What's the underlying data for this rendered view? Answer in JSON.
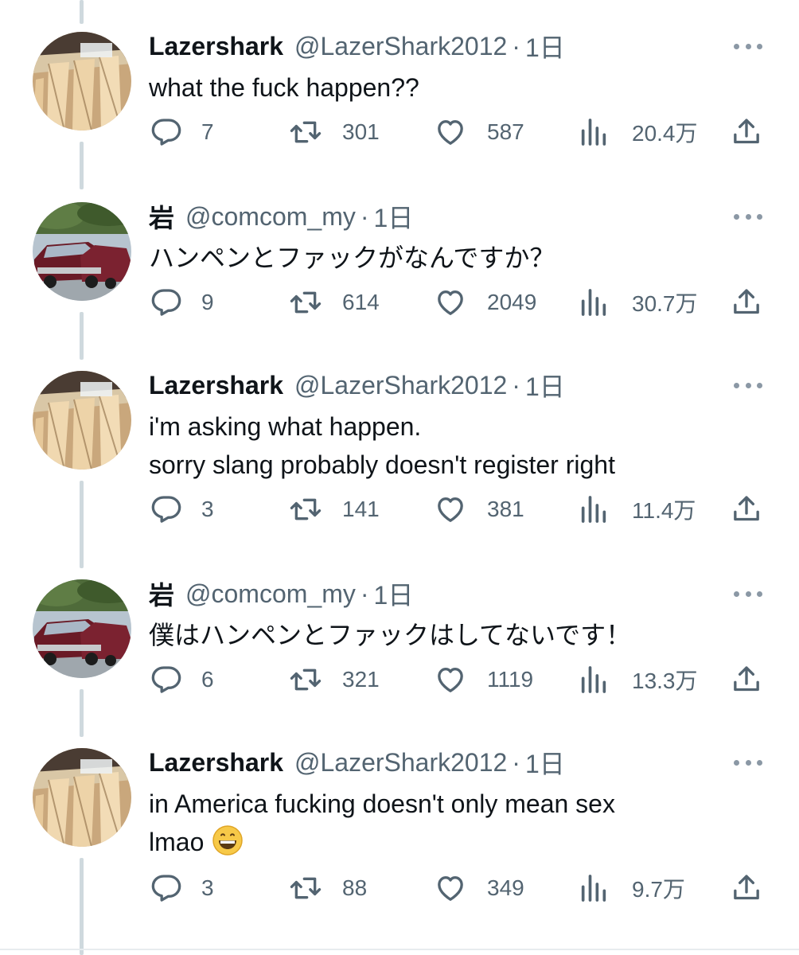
{
  "colors": {
    "text": "#0f1419",
    "secondary": "#536471",
    "thread_line": "#cfd9de"
  },
  "tweets": [
    {
      "name": "Lazershark",
      "handle": "@LazerShark2012",
      "dot": "·",
      "time": "1日",
      "avatar": "anime-hands-avatar",
      "text": [
        "what the fuck happen??"
      ],
      "replies": "7",
      "retweets": "301",
      "likes": "587",
      "views": "20.4万"
    },
    {
      "name": "岩",
      "handle": "@comcom_my",
      "dot": "·",
      "time": "1日",
      "avatar": "red-cars-avatar",
      "text": [
        "ハンペンとファックがなんですか？"
      ],
      "replies": "9",
      "retweets": "614",
      "likes": "2049",
      "views": "30.7万"
    },
    {
      "name": "Lazershark",
      "handle": "@LazerShark2012",
      "dot": "·",
      "time": "1日",
      "avatar": "anime-hands-avatar",
      "text": [
        "i'm asking what happen.",
        "sorry slang probably doesn't register right"
      ],
      "replies": "3",
      "retweets": "141",
      "likes": "381",
      "views": "11.4万"
    },
    {
      "name": "岩",
      "handle": "@comcom_my",
      "dot": "·",
      "time": "1日",
      "avatar": "red-cars-avatar",
      "text": [
        "僕はハンペンとファックはしてないです！"
      ],
      "replies": "6",
      "retweets": "321",
      "likes": "1119",
      "views": "13.3万"
    },
    {
      "name": "Lazershark",
      "handle": "@LazerShark2012",
      "dot": "·",
      "time": "1日",
      "avatar": "anime-hands-avatar",
      "text": [
        "in America fucking doesn't only mean sex",
        "lmao"
      ],
      "emoji": "grinning-face-emoji",
      "replies": "3",
      "retweets": "88",
      "likes": "349",
      "views": "9.7万"
    }
  ]
}
